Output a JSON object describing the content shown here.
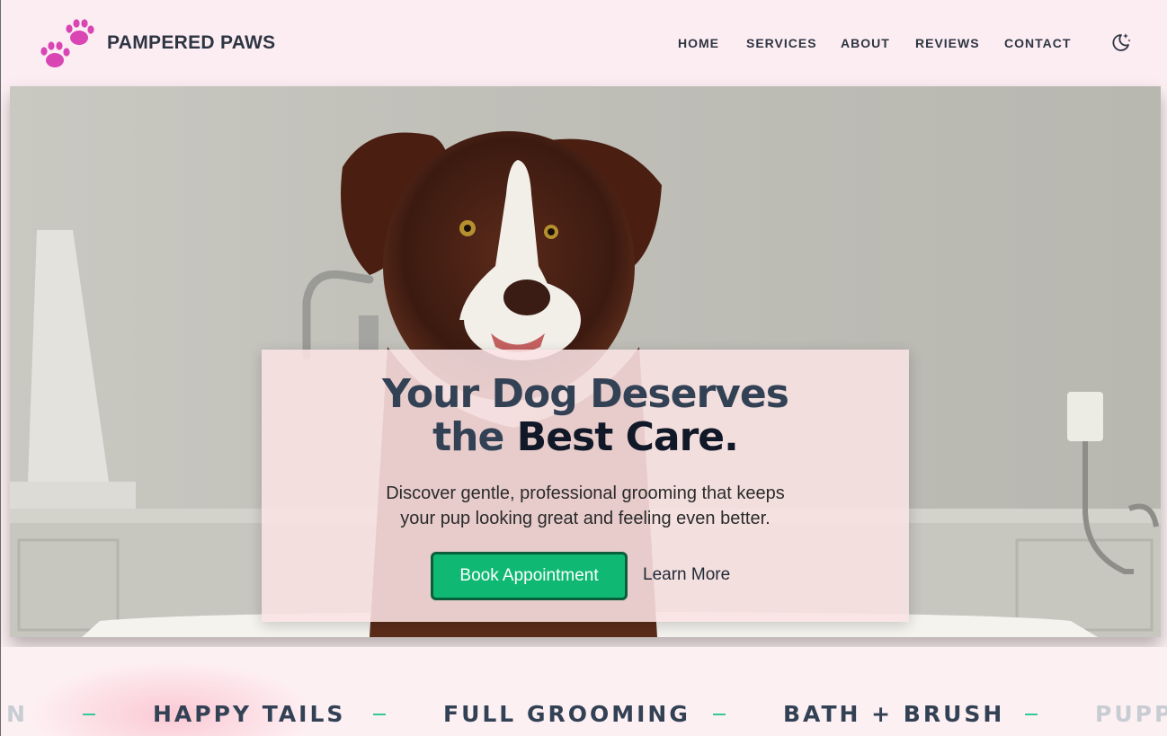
{
  "brand": {
    "name": "PAMPERED PAWS",
    "icon": "paw-prints-icon",
    "accent": "#d946b4"
  },
  "nav": {
    "items": [
      {
        "label": "HOME"
      },
      {
        "label": "SERVICES"
      },
      {
        "label": "ABOUT"
      },
      {
        "label": "REVIEWS"
      },
      {
        "label": "CONTACT"
      }
    ],
    "theme_toggle_icon": "moon-stars-icon"
  },
  "hero": {
    "title_line1": "Your Dog Deserves",
    "title_line2_a": "the",
    "title_line2_b": "Best Care.",
    "subtitle_line1": "Discover gentle, professional grooming that keeps",
    "subtitle_line2": "your pup looking great and feeling even better.",
    "primary_button": "Book Appointment",
    "secondary_link": "Learn More",
    "primary_color": "#10b973",
    "image": "border-collie-in-bathtub"
  },
  "marquee": {
    "items": [
      "N",
      "HAPPY TAILS",
      "FULL GROOMING",
      "BATH + BRUSH",
      "PUPP"
    ],
    "separator_color": "#34c79a"
  }
}
